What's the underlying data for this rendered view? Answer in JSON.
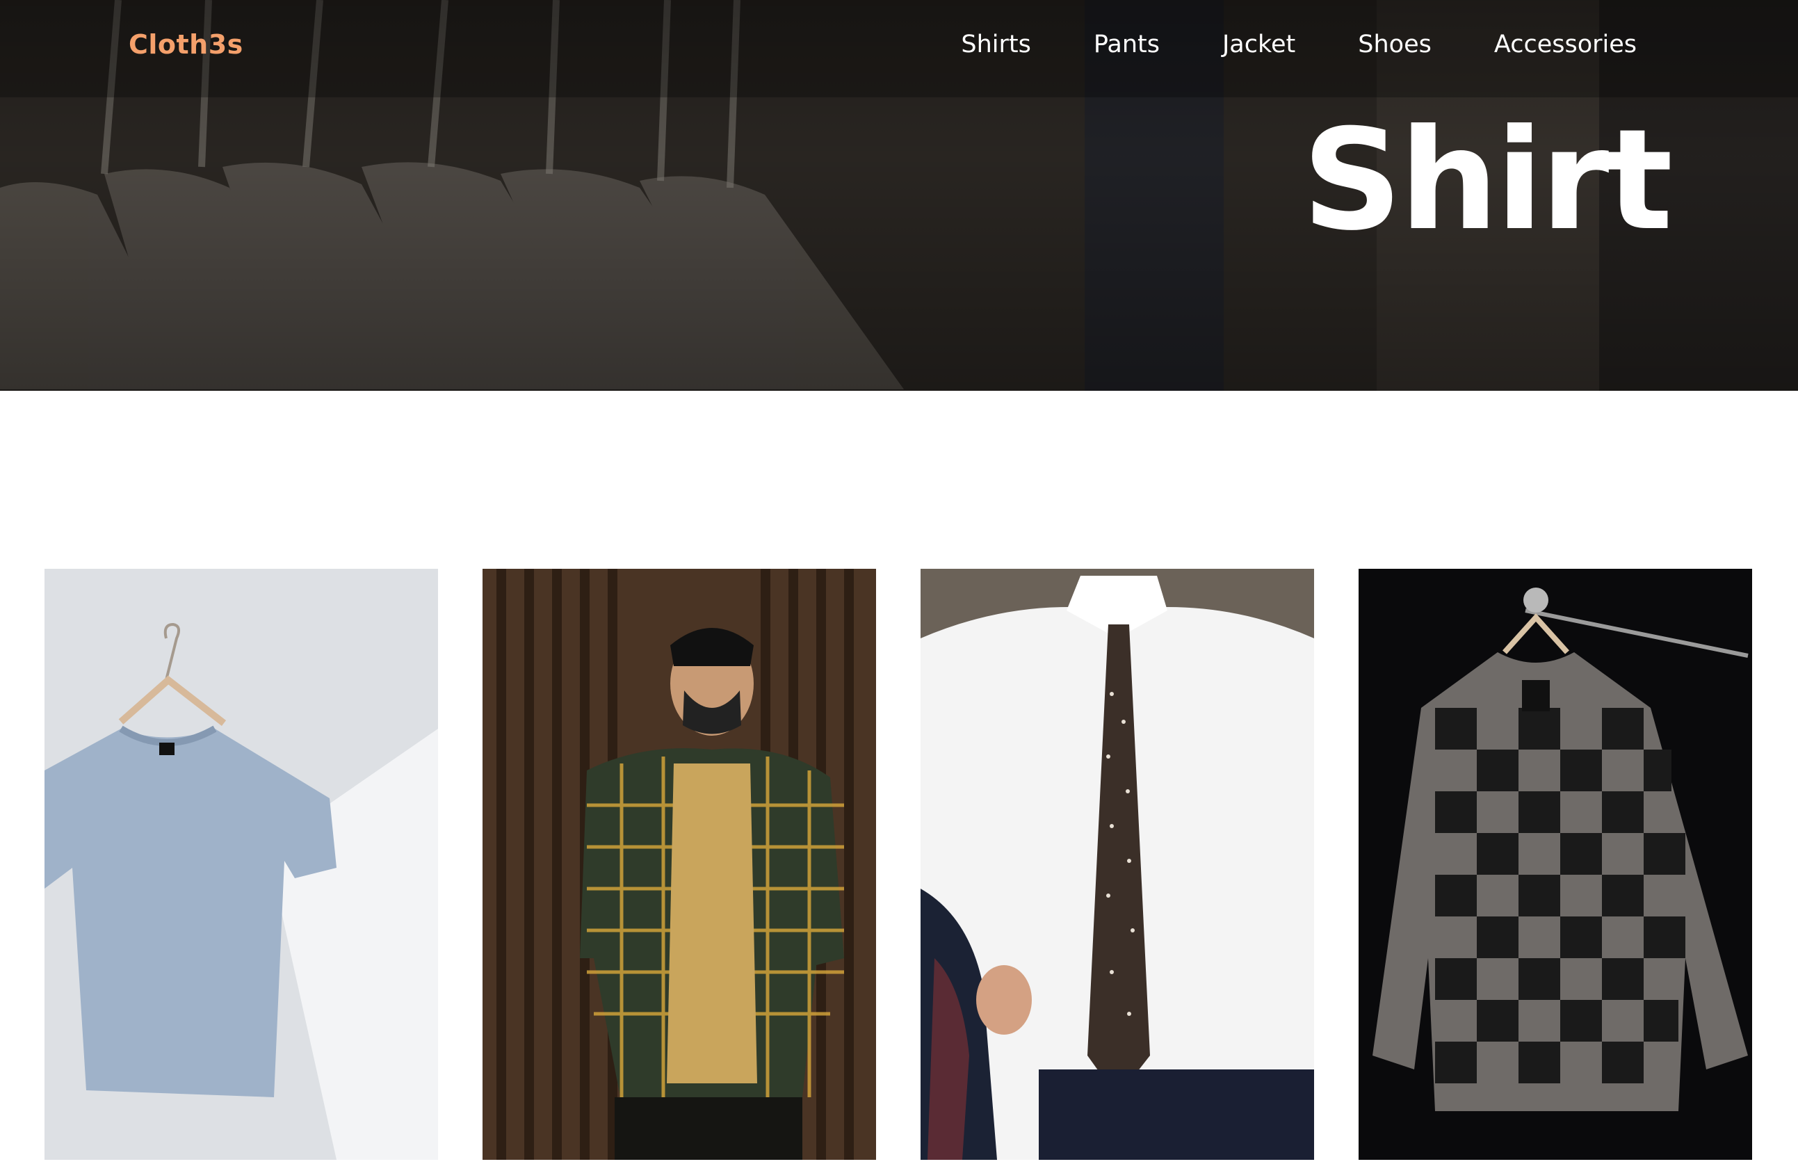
{
  "header": {
    "logo": "Cloth3s",
    "nav": [
      "Shirts",
      "Pants",
      "Jacket",
      "Shoes",
      "Accessories"
    ]
  },
  "hero": {
    "title": "Shirt"
  },
  "colors": {
    "brand": "#f4a06b",
    "nav_text": "#ffffff"
  },
  "gallery": {
    "items": [
      {
        "image": "grey-tshirt-on-hanger"
      },
      {
        "image": "man-in-plaid-shirt-with-mask"
      },
      {
        "image": "white-dress-shirt-with-tie"
      },
      {
        "image": "grey-black-flannel-on-hanger"
      }
    ]
  }
}
